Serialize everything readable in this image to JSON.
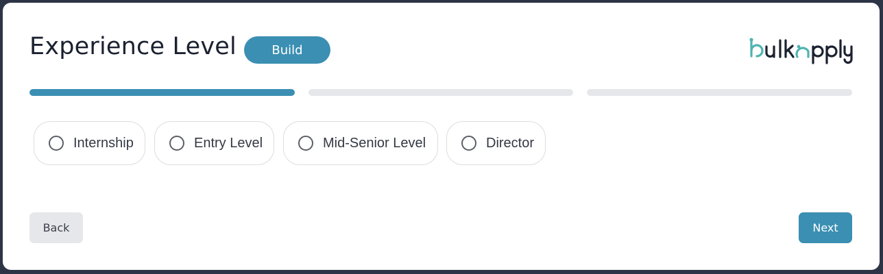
{
  "header": {
    "title": "Experience Level",
    "badge": "Build",
    "logo_text": "bulkapply"
  },
  "progress": {
    "steps_total": 3,
    "current_step": 1
  },
  "options": [
    {
      "label": "Internship",
      "selected": false
    },
    {
      "label": "Entry Level",
      "selected": false
    },
    {
      "label": "Mid-Senior Level",
      "selected": false
    },
    {
      "label": "Director",
      "selected": false
    }
  ],
  "footer": {
    "back_label": "Back",
    "next_label": "Next"
  },
  "colors": {
    "accent": "#3b8fb2",
    "logo_teal": "#4fb3b0",
    "text_dark": "#1b2130",
    "track": "#e6e7eb",
    "frame": "#2d3446"
  }
}
